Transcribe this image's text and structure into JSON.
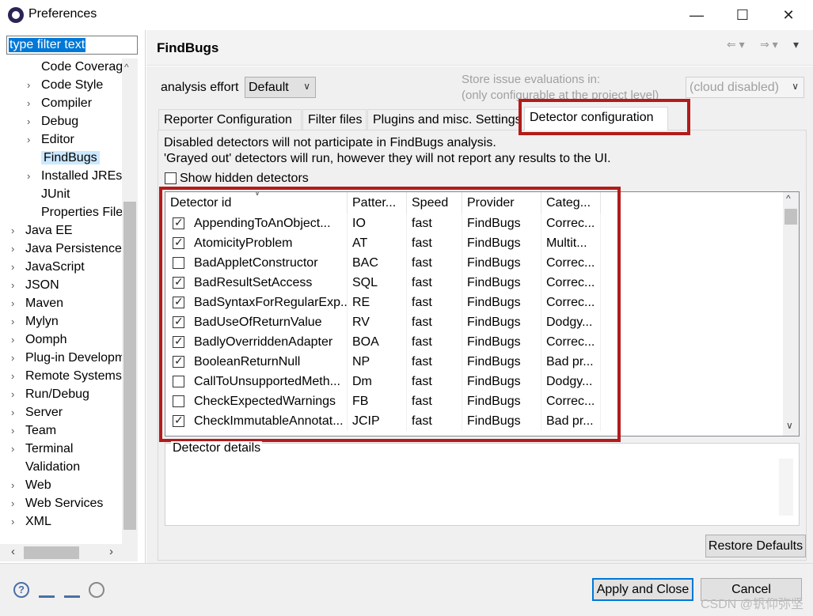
{
  "window": {
    "title": "Preferences",
    "minimize": "—",
    "maximize": "☐",
    "close": "✕"
  },
  "filter": {
    "value": "type filter text"
  },
  "tree": [
    {
      "label": "Code Coverag",
      "indent": 2,
      "chevron": ""
    },
    {
      "label": "Code Style",
      "indent": 2,
      "chevron": "›"
    },
    {
      "label": "Compiler",
      "indent": 2,
      "chevron": "›"
    },
    {
      "label": "Debug",
      "indent": 2,
      "chevron": "›"
    },
    {
      "label": "Editor",
      "indent": 2,
      "chevron": "›"
    },
    {
      "label": "FindBugs",
      "indent": 2,
      "chevron": "",
      "selected": true
    },
    {
      "label": "Installed JREs",
      "indent": 2,
      "chevron": "›"
    },
    {
      "label": "JUnit",
      "indent": 2,
      "chevron": ""
    },
    {
      "label": "Properties File",
      "indent": 2,
      "chevron": ""
    },
    {
      "label": "Java EE",
      "indent": 1,
      "chevron": "›"
    },
    {
      "label": "Java Persistence",
      "indent": 1,
      "chevron": "›"
    },
    {
      "label": "JavaScript",
      "indent": 1,
      "chevron": "›"
    },
    {
      "label": "JSON",
      "indent": 1,
      "chevron": "›"
    },
    {
      "label": "Maven",
      "indent": 1,
      "chevron": "›"
    },
    {
      "label": "Mylyn",
      "indent": 1,
      "chevron": "›"
    },
    {
      "label": "Oomph",
      "indent": 1,
      "chevron": "›"
    },
    {
      "label": "Plug-in Developm",
      "indent": 1,
      "chevron": "›"
    },
    {
      "label": "Remote Systems",
      "indent": 1,
      "chevron": "›"
    },
    {
      "label": "Run/Debug",
      "indent": 1,
      "chevron": "›"
    },
    {
      "label": "Server",
      "indent": 1,
      "chevron": "›"
    },
    {
      "label": "Team",
      "indent": 1,
      "chevron": "›"
    },
    {
      "label": "Terminal",
      "indent": 1,
      "chevron": "›"
    },
    {
      "label": "Validation",
      "indent": 1,
      "chevron": ""
    },
    {
      "label": "Web",
      "indent": 1,
      "chevron": "›"
    },
    {
      "label": "Web Services",
      "indent": 1,
      "chevron": "›"
    },
    {
      "label": "XML",
      "indent": 1,
      "chevron": "›"
    }
  ],
  "page": {
    "title": "FindBugs",
    "analysis_effort_label": "analysis effort",
    "analysis_effort_value": "Default",
    "store_line1": "Store issue evaluations in:",
    "store_line2": "(only configurable at the project level)",
    "cloud_value": "(cloud disabled)"
  },
  "tabs": [
    {
      "label": "Reporter Configuration"
    },
    {
      "label": "Filter files"
    },
    {
      "label": "Plugins and misc. Settings"
    },
    {
      "label": "Detector configuration",
      "active": true
    }
  ],
  "detector_tab": {
    "info_line1": "Disabled detectors will not participate in FindBugs analysis.",
    "info_line2": "'Grayed out' detectors will run, however they will not report any results to the UI.",
    "show_hidden_label": "Show hidden detectors",
    "show_hidden_checked": false,
    "columns": [
      "Detector id",
      "Patter...",
      "Speed",
      "Provider",
      "Categ..."
    ],
    "rows": [
      {
        "checked": true,
        "id": "AppendingToAnObject...",
        "pattern": "IO",
        "speed": "fast",
        "provider": "FindBugs",
        "category": "Correc..."
      },
      {
        "checked": true,
        "id": "AtomicityProblem",
        "pattern": "AT",
        "speed": "fast",
        "provider": "FindBugs",
        "category": "Multit..."
      },
      {
        "checked": false,
        "id": "BadAppletConstructor",
        "pattern": "BAC",
        "speed": "fast",
        "provider": "FindBugs",
        "category": "Correc..."
      },
      {
        "checked": true,
        "id": "BadResultSetAccess",
        "pattern": "SQL",
        "speed": "fast",
        "provider": "FindBugs",
        "category": "Correc..."
      },
      {
        "checked": true,
        "id": "BadSyntaxForRegularExp...",
        "pattern": "RE",
        "speed": "fast",
        "provider": "FindBugs",
        "category": "Correc..."
      },
      {
        "checked": true,
        "id": "BadUseOfReturnValue",
        "pattern": "RV",
        "speed": "fast",
        "provider": "FindBugs",
        "category": "Dodgy..."
      },
      {
        "checked": true,
        "id": "BadlyOverriddenAdapter",
        "pattern": "BOA",
        "speed": "fast",
        "provider": "FindBugs",
        "category": "Correc..."
      },
      {
        "checked": true,
        "id": "BooleanReturnNull",
        "pattern": "NP",
        "speed": "fast",
        "provider": "FindBugs",
        "category": "Bad pr..."
      },
      {
        "checked": false,
        "id": "CallToUnsupportedMeth...",
        "pattern": "Dm",
        "speed": "fast",
        "provider": "FindBugs",
        "category": "Dodgy..."
      },
      {
        "checked": false,
        "id": "CheckExpectedWarnings",
        "pattern": "FB",
        "speed": "fast",
        "provider": "FindBugs",
        "category": "Correc..."
      },
      {
        "checked": true,
        "id": "CheckImmutableAnnotat...",
        "pattern": "JCIP",
        "speed": "fast",
        "provider": "FindBugs",
        "category": "Bad pr..."
      }
    ],
    "details_label": "Detector details",
    "restore_defaults": "Restore Defaults"
  },
  "footer": {
    "apply_close": "Apply and Close",
    "cancel": "Cancel",
    "watermark": "CSDN @钒仰弥坚"
  },
  "colors": {
    "highlight": "#b31b1b",
    "selection": "#0078d7",
    "tree_selected": "#cce8ff"
  }
}
